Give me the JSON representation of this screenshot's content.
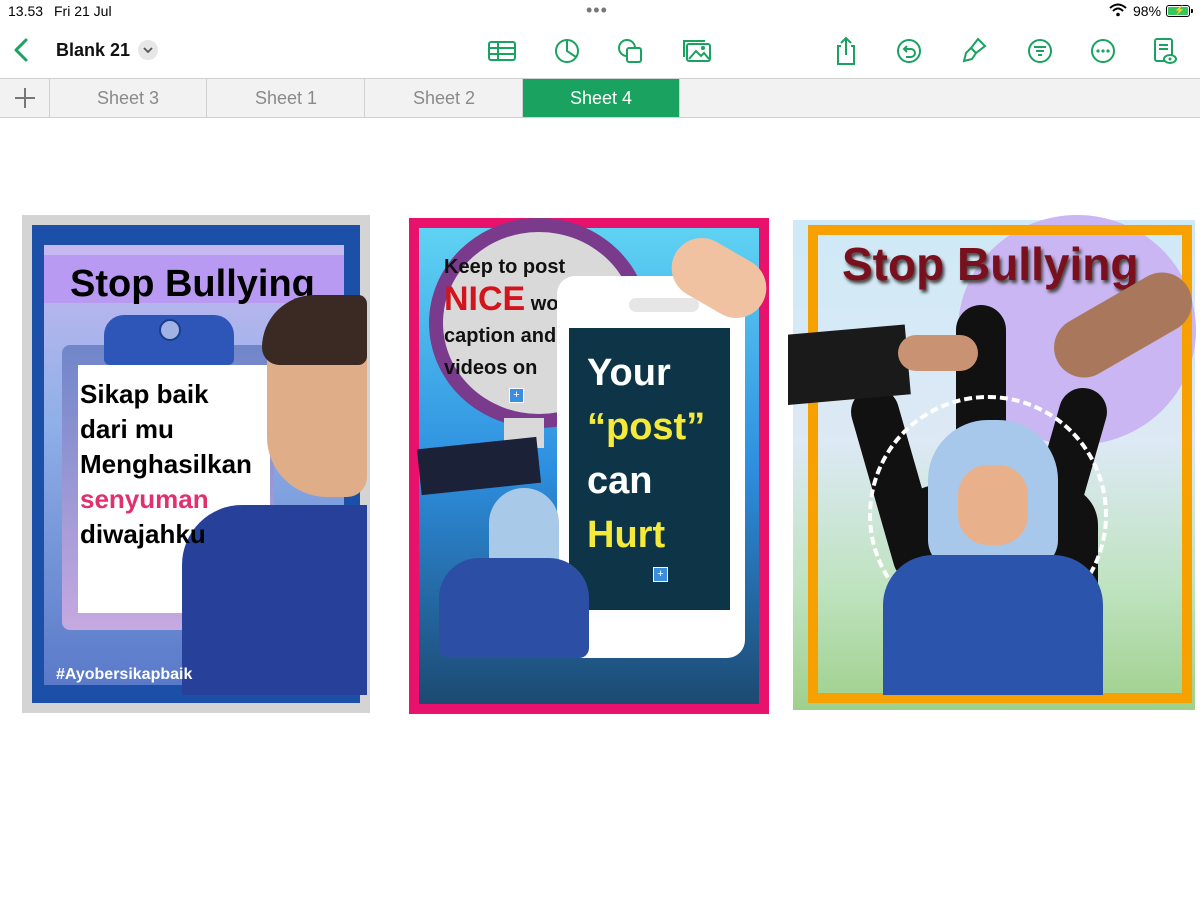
{
  "status": {
    "time": "13.53",
    "date": "Fri 21 Jul",
    "battery": "98%"
  },
  "app": {
    "title": "Blank 21"
  },
  "colors": {
    "accent": "#1aa260"
  },
  "toolbar": {
    "left_icons": [
      "table-icon",
      "chart-icon",
      "shape-icon",
      "media-icon"
    ],
    "right_icons": [
      "share-icon",
      "undo-icon",
      "format-brush-icon",
      "filter-icon",
      "more-icon",
      "reader-view-icon"
    ]
  },
  "tabs": [
    {
      "label": "Sheet 3",
      "active": false
    },
    {
      "label": "Sheet 1",
      "active": false
    },
    {
      "label": "Sheet 2",
      "active": false
    },
    {
      "label": "Sheet 4",
      "active": true
    }
  ],
  "posters": {
    "p1": {
      "title": "Stop Bullying",
      "line1": "Sikap baik",
      "line2": "dari mu",
      "line3": "Menghasilkan",
      "line4": "senyuman",
      "line5": "diwajahku",
      "hashtag": "#Ayobersikapbaik"
    },
    "p2": {
      "line1": "Keep to post",
      "nice": "NICE",
      "words": "words,",
      "line3": "caption and",
      "line4": "videos on",
      "your": "Your",
      "post": "“post”",
      "can": "can",
      "hurt": "Hurt"
    },
    "p3": {
      "title": "Stop Bullying"
    }
  }
}
